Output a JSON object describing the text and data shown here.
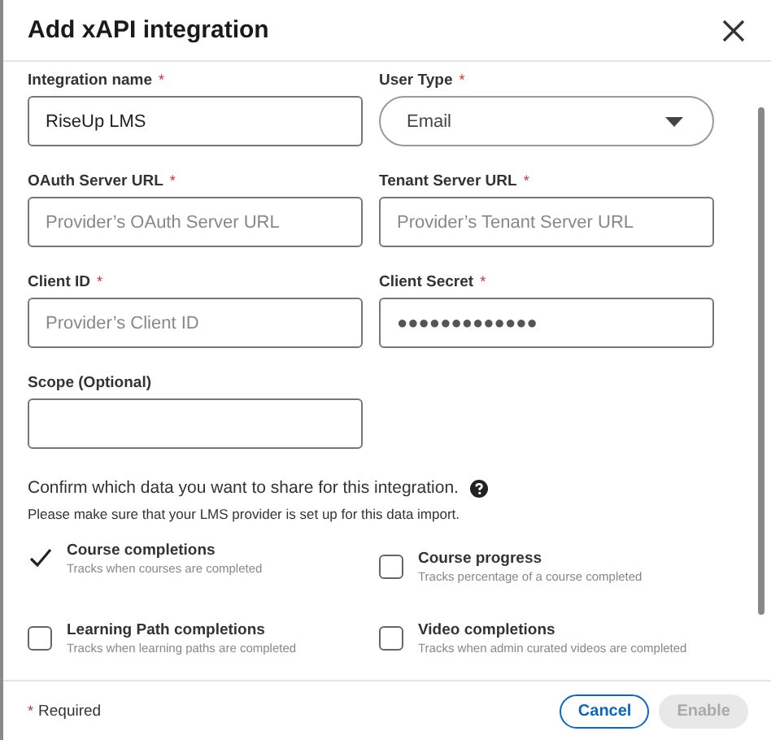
{
  "dialog": {
    "title": "Add xAPI integration"
  },
  "fields": [
    {
      "kind": "text",
      "label": "Integration name",
      "required_mark": "*",
      "value": "RiseUp LMS"
    },
    {
      "kind": "select",
      "label": "User Type",
      "required_mark": "*",
      "value": "Email"
    },
    {
      "kind": "text",
      "label": "OAuth Server URL",
      "required_mark": "*",
      "placeholder": "Provider’s OAuth Server URL"
    },
    {
      "kind": "text",
      "label": "Tenant Server URL",
      "required_mark": "*",
      "placeholder": "Provider’s Tenant Server URL"
    },
    {
      "kind": "text",
      "label": "Client ID",
      "required_mark": "*",
      "placeholder": "Provider’s Client ID"
    },
    {
      "kind": "secret",
      "label": "Client Secret",
      "required_mark": "*",
      "value": "●●●●●●●●●●●●●"
    },
    {
      "kind": "text",
      "label": "Scope (Optional)"
    }
  ],
  "share": {
    "prompt": "Confirm which data you want to share for this integration.",
    "note": "Please make sure that your LMS provider is set up for this data import.",
    "options": [
      {
        "label": "Course completions",
        "description": "Tracks when courses are completed",
        "checked": true
      },
      {
        "label": "Course progress",
        "description": "Tracks percentage of a course completed",
        "checked": false
      },
      {
        "label": "Learning Path completions",
        "description": "Tracks when learning paths are completed",
        "checked": false
      },
      {
        "label": "Video completions",
        "description": "Tracks when admin curated videos are completed",
        "checked": false
      }
    ]
  },
  "footer": {
    "required_mark": "*",
    "required_text": "Required",
    "buttons": [
      {
        "label": "Cancel",
        "disabled": false
      },
      {
        "label": "Enable",
        "disabled": true
      }
    ]
  }
}
